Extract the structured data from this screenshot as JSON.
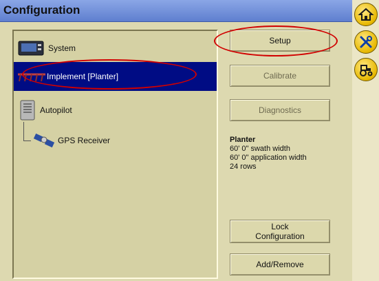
{
  "window": {
    "title": "Configuration"
  },
  "side_buttons": [
    {
      "icon": "home-icon"
    },
    {
      "icon": "tools-icon"
    },
    {
      "icon": "tractor-icon"
    }
  ],
  "tree": [
    {
      "label": "System",
      "icon": "display-unit-icon"
    },
    {
      "label": "Implement [Planter]",
      "icon": "planter-icon",
      "selected": true
    },
    {
      "label": "Autopilot",
      "icon": "autopilot-controller-icon"
    },
    {
      "label": "GPS Receiver",
      "icon": "gps-satellite-icon"
    }
  ],
  "buttons": {
    "setup": "Setup",
    "calibrate": "Calibrate",
    "diagnostics": "Diagnostics",
    "lock_configuration": "Lock\nConfiguration",
    "add_remove": "Add/Remove"
  },
  "info": {
    "name": "Planter",
    "lines": [
      "60' 0\" swath width",
      "60' 0\" application width",
      "24 rows"
    ]
  },
  "colors": {
    "titlebar": "#6f8fdc",
    "selection": "#000c84",
    "highlight_ellipse": "#d10000",
    "panel_bg": "#ddd9b0"
  }
}
